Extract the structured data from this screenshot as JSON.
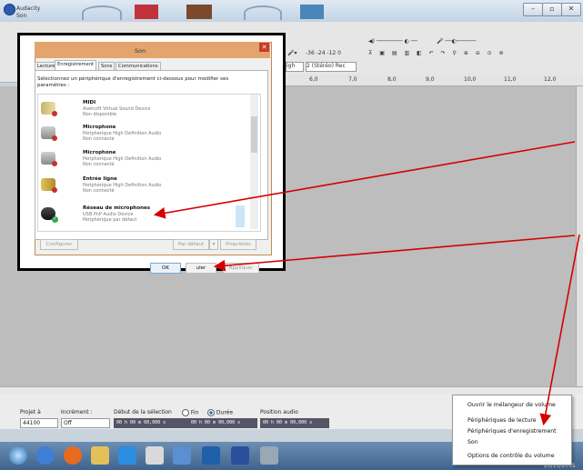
{
  "window": {
    "title": "Audacity",
    "subtitle": "Son"
  },
  "toolbar": {
    "meter_scale": "-36  -24  -12  0",
    "rate_value": "2 (Stéréo) Rec",
    "high_value": "igh"
  },
  "ruler": {
    "ticks": [
      "6,0",
      "7,0",
      "8,0",
      "9,0",
      "10,0",
      "11,0",
      "12,0"
    ]
  },
  "selection_bar": {
    "project_label": "Projet à",
    "rate_value": "44100",
    "snap_label": "Incrément :",
    "snap_value": "Off",
    "start_label": "Début de la sélection",
    "end_label": "Fin",
    "duration_label": "Durée",
    "audio_pos_label": "Position audio",
    "start_time": "00 h 00 m 00,000 s",
    "length_time": "00 h 00 m 00,000 s",
    "audio_time": "00 h 00 m 00,000 s"
  },
  "context_menu": {
    "items": [
      "Ouvrir le mélangeur de volume",
      "Périphériques de lecture",
      "Périphériques d'enregistrement",
      "Son",
      "Options de contrôle du volume"
    ]
  },
  "taskbar": {
    "clock": "20/10/2015"
  },
  "dialog": {
    "title": "Son",
    "tabs": [
      "Lecture",
      "Enregistrement",
      "Sons",
      "Communications"
    ],
    "instruction": "Sélectionnez un périphérique d'enregistrement ci-dessous pour modifier ses paramètres :",
    "devices": [
      {
        "name": "MIDI",
        "sub1": "Asetcoft Virtual Sound Device",
        "sub2": "Non disponible"
      },
      {
        "name": "Microphone",
        "sub1": "Périphérique High Definition Audio",
        "sub2": "Non connecté"
      },
      {
        "name": "Microphone",
        "sub1": "Périphérique High Definition Audio",
        "sub2": "Non connecté"
      },
      {
        "name": "Entrée ligne",
        "sub1": "Périphérique High Definition Audio",
        "sub2": "Non connecté"
      },
      {
        "name": "Réseau de microphones",
        "sub1": "USB PnP Audio Device",
        "sub2": "Périphérique par défaut"
      }
    ],
    "configure_label": "Configurer",
    "default_label": "Par défaut",
    "properties_label": "Propriétés",
    "ok_label": "OK",
    "cancel_label": "uler",
    "apply_label": "Appliquer"
  }
}
